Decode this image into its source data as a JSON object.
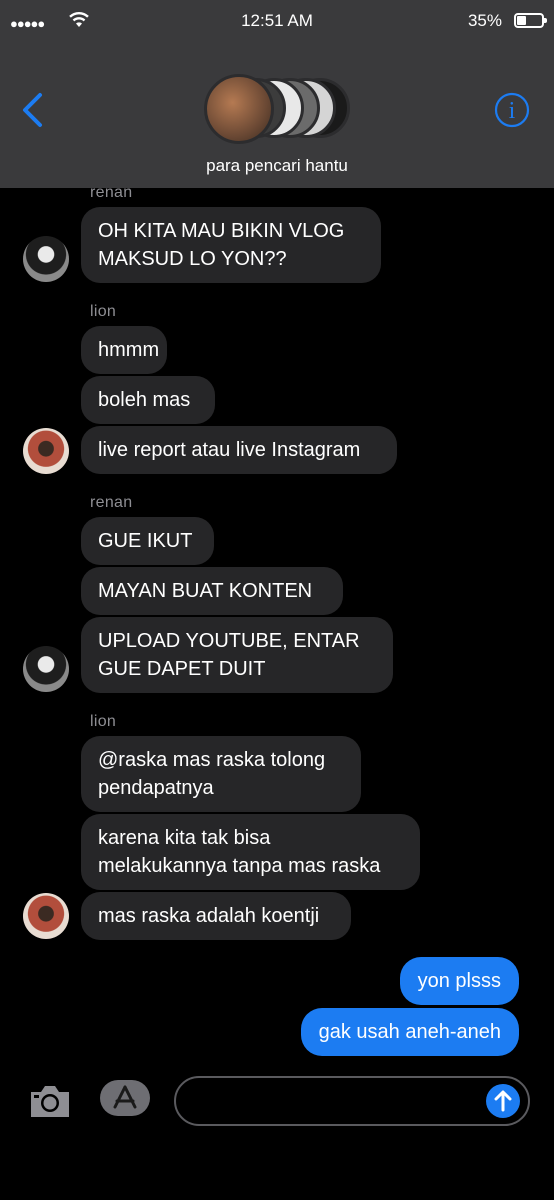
{
  "status_bar": {
    "signal": "●●●●●",
    "time": "12:51 AM",
    "battery": "35%"
  },
  "header": {
    "group_name": "para pencari hantu",
    "info_label": "i"
  },
  "colors": {
    "bubble_in": "#262628",
    "bubble_out": "#1c7cf2",
    "accent": "#1c7cf2",
    "sender_name": "#8e8e93"
  },
  "messages": {
    "renan_1": {
      "sender": "renan",
      "m1": "OH KITA MAU BIKIN VLOG\nMAKSUD LO YON??"
    },
    "lion_1": {
      "sender": "lion",
      "m1": "hmmm",
      "m2": "boleh mas",
      "m3": "live report atau live Instagram"
    },
    "renan_2": {
      "sender": "renan",
      "m1": "GUE IKUT",
      "m2": "MAYAN BUAT KONTEN",
      "m3": "UPLOAD YOUTUBE, ENTAR\nGUE DAPET DUIT"
    },
    "lion_2": {
      "sender": "lion",
      "m1": "@raska mas raska tolong\npendapatnya",
      "m2": "karena kita tak bisa\nmelakukannya tanpa mas raska",
      "m3": "mas raska adalah koentji"
    },
    "me": {
      "m1": "yon plsss",
      "m2": "gak usah aneh-aneh"
    }
  },
  "composer": {
    "camera_icon": "camera-icon",
    "apps_icon": "app-store-icon",
    "send_icon": "arrow-up-icon",
    "text": ""
  }
}
